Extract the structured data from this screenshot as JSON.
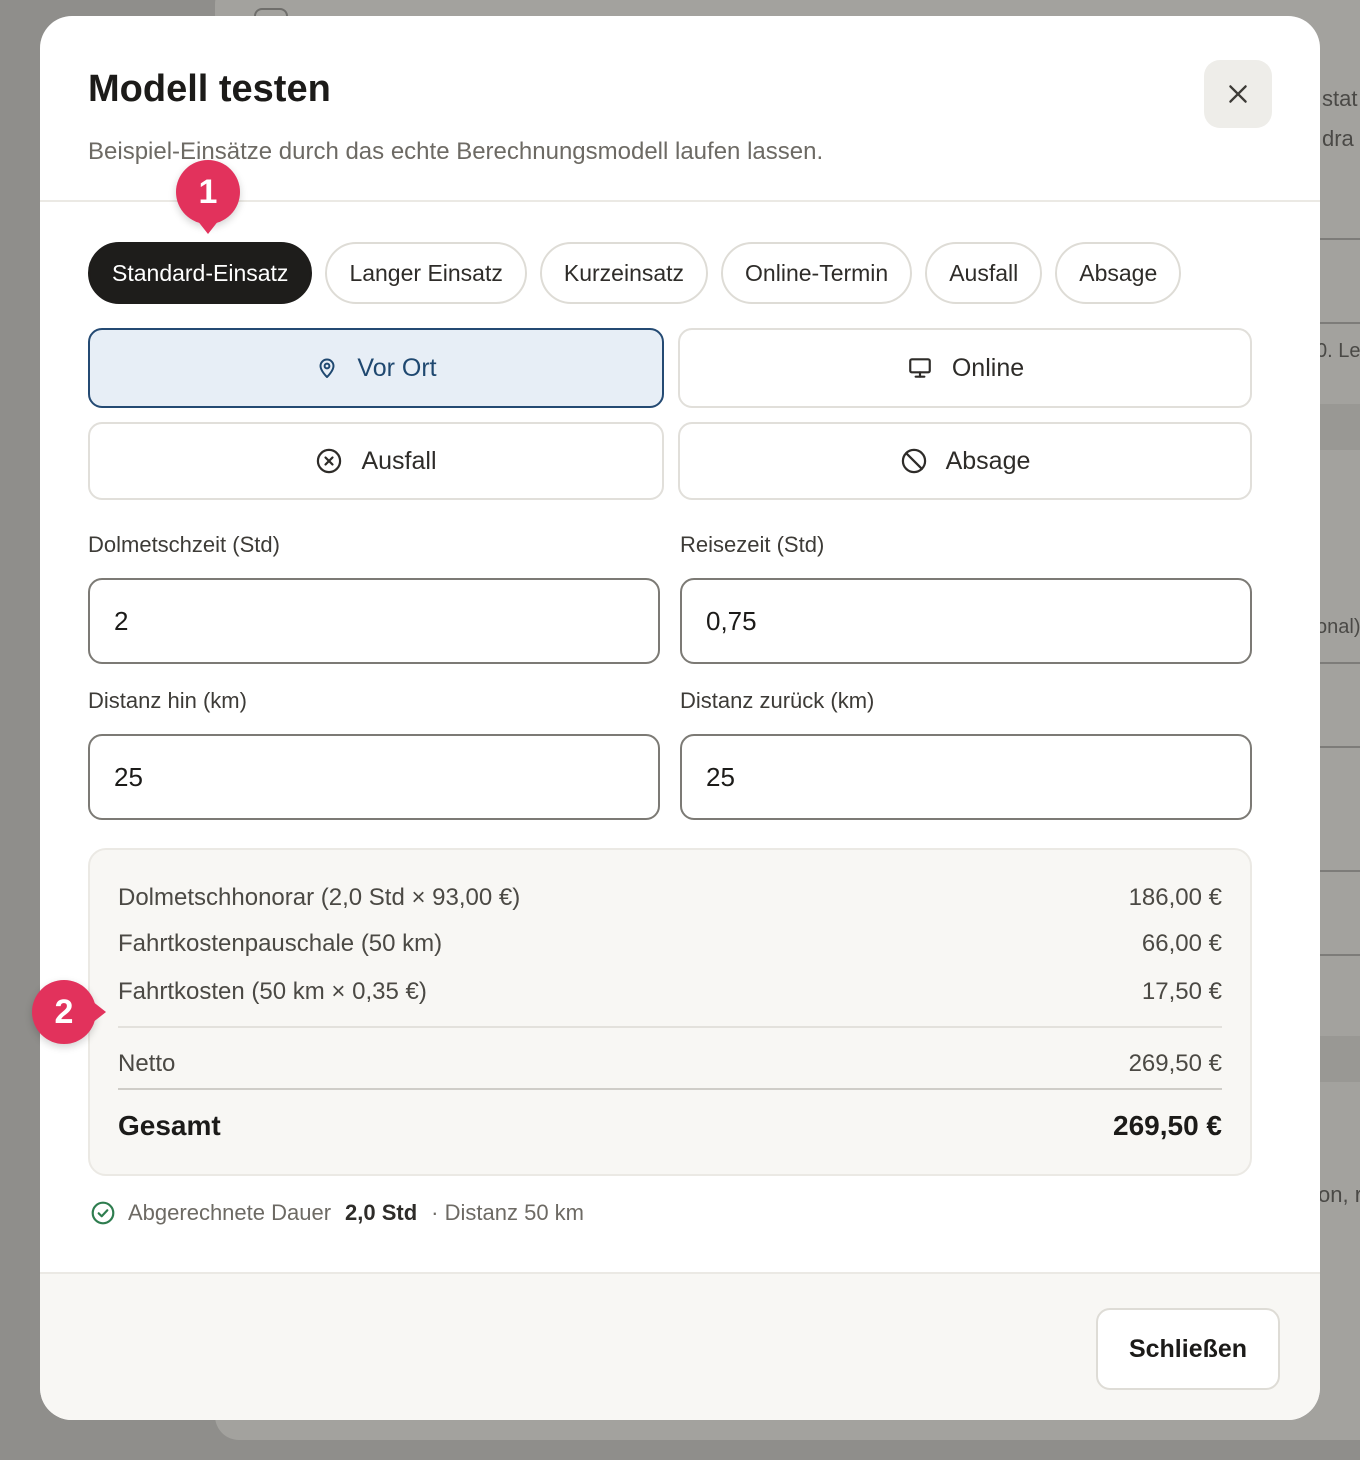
{
  "background": {
    "fragments": [
      "stat",
      "dra",
      "0. Le",
      "onal)",
      "on, r"
    ]
  },
  "modal": {
    "title": "Modell testen",
    "subtitle": "Beispiel-Einsätze durch das echte Berechnungsmodell laufen lassen.",
    "close_icon": "close-icon"
  },
  "presets": [
    {
      "label": "Standard-Einsatz",
      "active": true
    },
    {
      "label": "Langer Einsatz",
      "active": false
    },
    {
      "label": "Kurzeinsatz",
      "active": false
    },
    {
      "label": "Online-Termin",
      "active": false
    },
    {
      "label": "Ausfall",
      "active": false
    },
    {
      "label": "Absage",
      "active": false
    }
  ],
  "modes": [
    {
      "label": "Vor Ort",
      "icon": "map-pin-icon",
      "selected": true
    },
    {
      "label": "Online",
      "icon": "monitor-icon",
      "selected": false
    },
    {
      "label": "Ausfall",
      "icon": "x-circle-icon",
      "selected": false
    },
    {
      "label": "Absage",
      "icon": "ban-icon",
      "selected": false
    }
  ],
  "fields": {
    "dolmetschzeit": {
      "label": "Dolmetschzeit (Std)",
      "value": "2"
    },
    "reisezeit": {
      "label": "Reisezeit (Std)",
      "value": "0,75"
    },
    "distanz_hin": {
      "label": "Distanz hin (km)",
      "value": "25"
    },
    "distanz_zurueck": {
      "label": "Distanz zurück (km)",
      "value": "25"
    }
  },
  "summary": {
    "lines": [
      {
        "label": "Dolmetschhonorar (2,0 Std × 93,00 €)",
        "amount": "186,00 €"
      },
      {
        "label": "Fahrtkostenpauschale (50 km)",
        "amount": "66,00 €"
      },
      {
        "label": "Fahrtkosten (50 km × 0,35 €)",
        "amount": "17,50 €"
      }
    ],
    "netto_label": "Netto",
    "netto_amount": "269,50 €",
    "gesamt_label": "Gesamt",
    "gesamt_amount": "269,50 €"
  },
  "footnote": {
    "icon": "check-circle-icon",
    "prefix": "Abgerechnete Dauer",
    "duration": "2,0 Std",
    "distance": "· Distanz 50 km"
  },
  "footer": {
    "close_label": "Schließen"
  },
  "markers": {
    "one": "1",
    "two": "2"
  },
  "colors": {
    "accent_selected": "#244a73",
    "marker": "#e2325c",
    "success": "#2e7d4f"
  }
}
